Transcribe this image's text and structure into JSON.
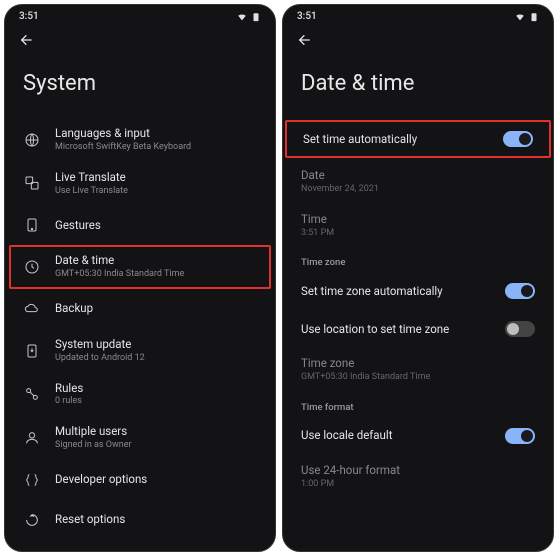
{
  "status": {
    "time": "3:51"
  },
  "left": {
    "title": "System",
    "items": [
      {
        "label": "Languages & input",
        "sub": "Microsoft SwiftKey Beta Keyboard"
      },
      {
        "label": "Live Translate",
        "sub": "Use Live Translate"
      },
      {
        "label": "Gestures",
        "sub": ""
      },
      {
        "label": "Date & time",
        "sub": "GMT+05:30 India Standard Time"
      },
      {
        "label": "Backup",
        "sub": ""
      },
      {
        "label": "System update",
        "sub": "Updated to Android 12"
      },
      {
        "label": "Rules",
        "sub": "0 rules"
      },
      {
        "label": "Multiple users",
        "sub": "Signed in as Owner"
      },
      {
        "label": "Developer options",
        "sub": ""
      },
      {
        "label": "Reset options",
        "sub": ""
      }
    ]
  },
  "right": {
    "title": "Date & time",
    "set_time_auto": "Set time automatically",
    "date_label": "Date",
    "date_value": "November 24, 2021",
    "time_label": "Time",
    "time_value": "3:51 PM",
    "section_tz": "Time zone",
    "set_tz_auto": "Set time zone automatically",
    "use_location_tz": "Use location to set time zone",
    "tz_label": "Time zone",
    "tz_value": "GMT+05:30 India Standard Time",
    "section_format": "Time format",
    "use_locale": "Use locale default",
    "use_24h": "Use 24-hour format",
    "use_24h_sub": "1:00 PM"
  }
}
